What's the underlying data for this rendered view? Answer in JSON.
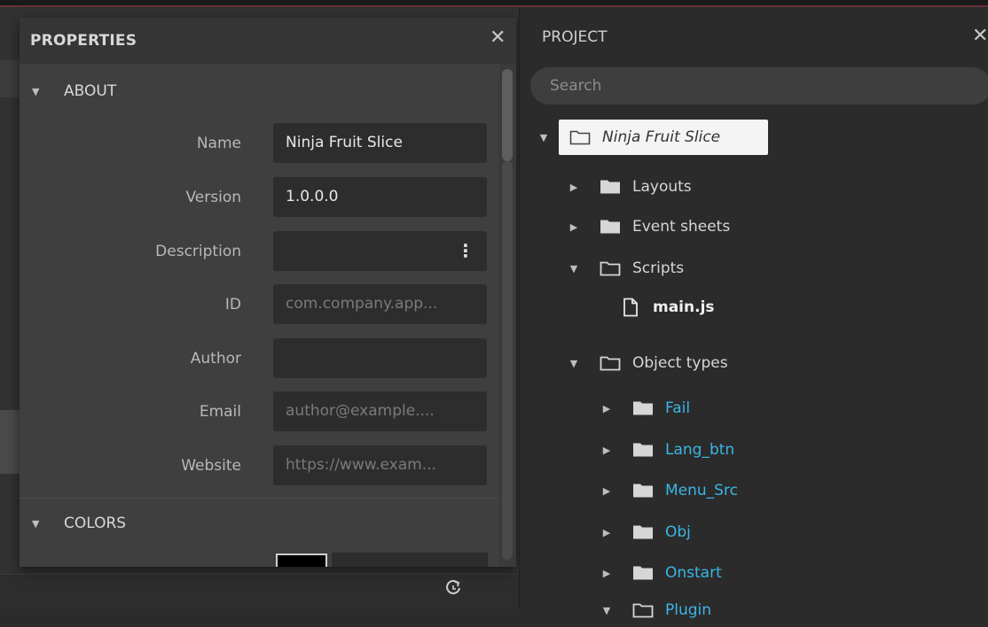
{
  "properties": {
    "title": "PROPERTIES",
    "sections": {
      "about": "ABOUT",
      "colors": "COLORS"
    },
    "fields": {
      "name": {
        "label": "Name",
        "value": "Ninja Fruit Slice"
      },
      "version": {
        "label": "Version",
        "value": "1.0.0.0"
      },
      "description": {
        "label": "Description",
        "value": ""
      },
      "id": {
        "label": "ID",
        "placeholder": "com.company.app..."
      },
      "author": {
        "label": "Author",
        "value": ""
      },
      "email": {
        "label": "Email",
        "placeholder": "author@example...."
      },
      "website": {
        "label": "Website",
        "placeholder": "https://www.exam..."
      }
    },
    "colors": {
      "swatch": "#000000"
    }
  },
  "project": {
    "title": "PROJECT",
    "search_placeholder": "Search",
    "root": "Ninja Fruit Slice",
    "tree": {
      "layouts": "Layouts",
      "event_sheets": "Event sheets",
      "scripts": "Scripts",
      "main_js": "main.js",
      "object_types": "Object types",
      "fail": "Fail",
      "lang_btn": "Lang_btn",
      "menu_src": "Menu_Src",
      "obj": "Obj",
      "onstart": "Onstart",
      "plugin": "Plugin"
    }
  },
  "colors": {
    "accent_cyan": "#3ab6e6",
    "panel": "#3f3f3f",
    "field": "#2d2d2d"
  }
}
